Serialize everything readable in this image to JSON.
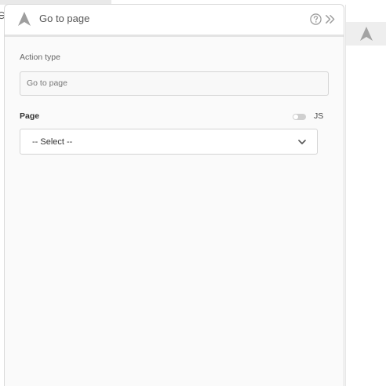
{
  "panel": {
    "title": "Go to page",
    "icons": {
      "header": "navigation-arrow-icon",
      "help": "help-circle-icon",
      "collapse": "double-chevron-right-icon"
    }
  },
  "action_type": {
    "label": "Action type",
    "value": "Go to page"
  },
  "page_field": {
    "label": "Page",
    "js_label": "JS",
    "js_enabled": false,
    "selected": "-- Select --",
    "icon": "chevron-down-icon"
  },
  "colors": {
    "panel_bg": "#fafafa",
    "header_bg": "#ffffff",
    "border": "#d9d9d9",
    "icon_gray": "#9e9e9e"
  }
}
